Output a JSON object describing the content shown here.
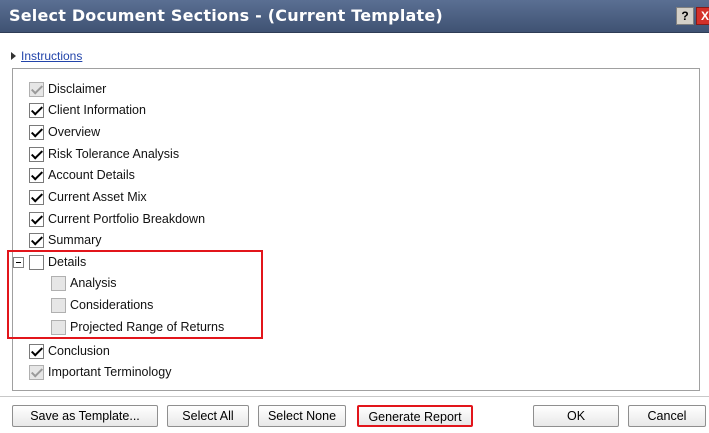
{
  "window": {
    "title": "Select Document Sections - (Current Template)",
    "help_label": "?",
    "close_label": "X"
  },
  "instructions": {
    "label": "Instructions"
  },
  "sections": [
    {
      "label": "Disclaimer",
      "checked": true,
      "disabled": true
    },
    {
      "label": "Client Information",
      "checked": true,
      "disabled": false
    },
    {
      "label": "Overview",
      "checked": true,
      "disabled": false
    },
    {
      "label": "Risk Tolerance Analysis",
      "checked": true,
      "disabled": false
    },
    {
      "label": "Account Details",
      "checked": true,
      "disabled": false
    },
    {
      "label": "Current Asset Mix",
      "checked": true,
      "disabled": false
    },
    {
      "label": "Current Portfolio Breakdown",
      "checked": true,
      "disabled": false
    },
    {
      "label": "Summary",
      "checked": true,
      "disabled": false
    },
    {
      "label": "Details",
      "checked": false,
      "disabled": false,
      "expanded": true,
      "children": [
        {
          "label": "Analysis",
          "checked": false,
          "disabled": true
        },
        {
          "label": "Considerations",
          "checked": false,
          "disabled": true
        },
        {
          "label": "Projected Range of Returns",
          "checked": false,
          "disabled": true
        }
      ]
    },
    {
      "label": "Conclusion",
      "checked": true,
      "disabled": false
    },
    {
      "label": "Important Terminology",
      "checked": true,
      "disabled": true
    }
  ],
  "buttons": {
    "save_template": "Save as Template...",
    "select_all": "Select All",
    "select_none": "Select None",
    "generate_report": "Generate Report",
    "ok": "OK",
    "cancel": "Cancel"
  },
  "colors": {
    "titlebar": "#4a5d80",
    "highlight": "#e2151b",
    "link": "#2244aa"
  }
}
